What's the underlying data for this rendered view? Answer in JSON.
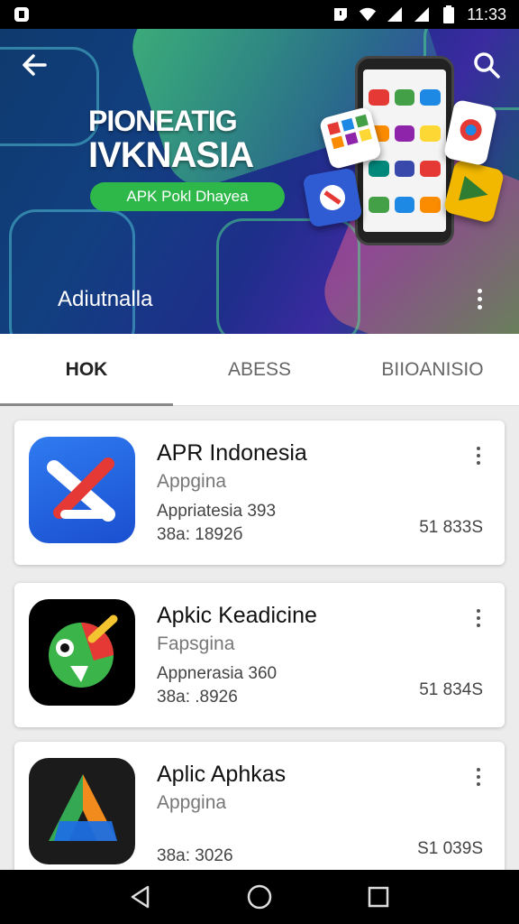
{
  "status_bar": {
    "time": "11:33",
    "icons": [
      "app-notification-icon",
      "alert-icon",
      "wifi-icon",
      "signal-icon",
      "signal-icon",
      "battery-icon"
    ]
  },
  "hero": {
    "title_line1": "PIONEATIG",
    "title_line2": "IVKNASIA",
    "pill": "APK Pokl Dhayea",
    "caption": "Adiutnalla",
    "icons": [
      "back-arrow-icon",
      "search-icon",
      "more-vert-icon"
    ]
  },
  "tabs": [
    {
      "label": "HOK",
      "active": true
    },
    {
      "label": "ABESS",
      "active": false
    },
    {
      "label": "BIIOANISIO",
      "active": false
    }
  ],
  "apps": [
    {
      "name": "APR Indonesia",
      "category": "Appgina",
      "line1": "Appriatesia 393",
      "line2": "38a: 1892б",
      "right": "51 833S",
      "icon": "x-logo-icon"
    },
    {
      "name": "Apkic Keadicine",
      "category": "Fapsgina",
      "line1": "Appnerasia 360",
      "line2": "38a: .8926",
      "right": "51 834S",
      "icon": "green-face-logo-icon"
    },
    {
      "name": "Aplic Aphkas",
      "category": "Appgina",
      "line1": "",
      "line2": "38a: 3026",
      "right": "S1 039S",
      "icon": "triangle-logo-icon"
    }
  ],
  "colors": {
    "accent_green": "#2fb84a",
    "status_bar": "#000000",
    "nav_bar": "#000000"
  },
  "nav": [
    "back-triangle-icon",
    "home-circle-icon",
    "recents-square-icon"
  ]
}
